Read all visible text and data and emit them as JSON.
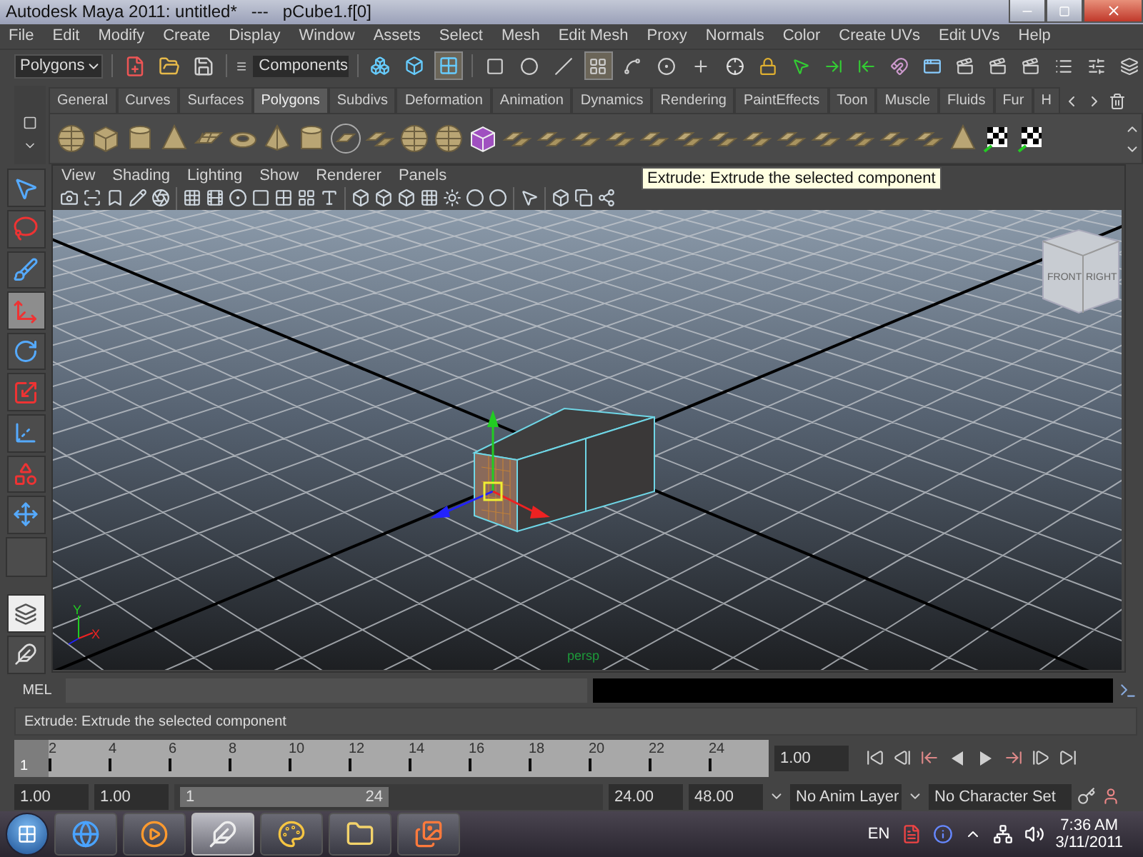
{
  "window": {
    "title": "Autodesk Maya 2011: untitled*   ---   pCube1.f[0]"
  },
  "menu_bar": [
    "File",
    "Edit",
    "Modify",
    "Create",
    "Display",
    "Window",
    "Assets",
    "Select",
    "Mesh",
    "Edit Mesh",
    "Proxy",
    "Normals",
    "Color",
    "Create UVs",
    "Edit UVs",
    "Help"
  ],
  "status_line": {
    "menu_set": "Polygons",
    "selection_mode": "Components",
    "mode_buttons": [
      {
        "selected": false
      },
      {
        "selected": false
      },
      {
        "selected": true
      }
    ],
    "mask_buttons": [
      {
        "selected": false
      },
      {
        "selected": false
      },
      {
        "selected": false
      },
      {
        "selected": true
      },
      {
        "selected": false
      },
      {
        "selected": false
      },
      {
        "selected": false
      }
    ]
  },
  "shelf": {
    "tabs": [
      {
        "label": "General",
        "selected": false
      },
      {
        "label": "Curves",
        "selected": false
      },
      {
        "label": "Surfaces",
        "selected": false
      },
      {
        "label": "Polygons",
        "selected": true
      },
      {
        "label": "Subdivs",
        "selected": false
      },
      {
        "label": "Deformation",
        "selected": false
      },
      {
        "label": "Animation",
        "selected": false
      },
      {
        "label": "Dynamics",
        "selected": false
      },
      {
        "label": "Rendering",
        "selected": false
      },
      {
        "label": "PaintEffects",
        "selected": false
      },
      {
        "label": "Toon",
        "selected": false
      },
      {
        "label": "Muscle",
        "selected": false
      },
      {
        "label": "Fluids",
        "selected": false
      },
      {
        "label": "Fur",
        "selected": false
      },
      {
        "label": "H",
        "selected": false
      }
    ]
  },
  "tools": [
    {
      "kind": "select",
      "selected": false
    },
    {
      "kind": "lasso",
      "selected": false
    },
    {
      "kind": "paint",
      "selected": false
    },
    {
      "kind": "move",
      "selected": true
    },
    {
      "kind": "rotate",
      "selected": false
    },
    {
      "kind": "scale",
      "selected": false
    },
    {
      "kind": "universal",
      "selected": false
    },
    {
      "kind": "soft",
      "selected": false
    },
    {
      "kind": "manip",
      "selected": false
    },
    {
      "kind": "empty",
      "selected": false
    }
  ],
  "panel": {
    "menus": [
      "View",
      "Shading",
      "Lighting",
      "Show",
      "Renderer",
      "Panels"
    ],
    "camera": "persp",
    "view_cube": {
      "front": "FRONT",
      "right": "RIGHT"
    },
    "axis": {
      "y": "Y",
      "x": "X"
    }
  },
  "tooltip": "Extrude: Extrude the selected component",
  "command_line": {
    "label": "MEL"
  },
  "help_line": "Extrude: Extrude the selected component",
  "time_slider": {
    "current_frame": "1",
    "level": 0,
    "ticks": [
      "2",
      "4",
      "6",
      "8",
      "10",
      "12",
      "14",
      "16",
      "18",
      "20",
      "22",
      "24"
    ],
    "current_time": "1.00"
  },
  "range_slider": {
    "start_time": "1.00",
    "playback_start": "1.00",
    "range_start": "1",
    "range_end": "24",
    "level": 0.5,
    "playback_end": "24.00",
    "end_time": "48.00",
    "anim_layer": "No Anim Layer",
    "character_set": "No Character Set"
  },
  "taskbar": {
    "apps": [
      {
        "kind": "browser",
        "selected": false
      },
      {
        "kind": "media",
        "selected": false
      },
      {
        "kind": "maya",
        "selected": true
      },
      {
        "kind": "paint",
        "selected": false
      },
      {
        "kind": "explorer",
        "selected": false
      },
      {
        "kind": "photos",
        "selected": false
      }
    ],
    "language": "EN",
    "time": "7:36 AM",
    "date": "3/11/2011"
  }
}
